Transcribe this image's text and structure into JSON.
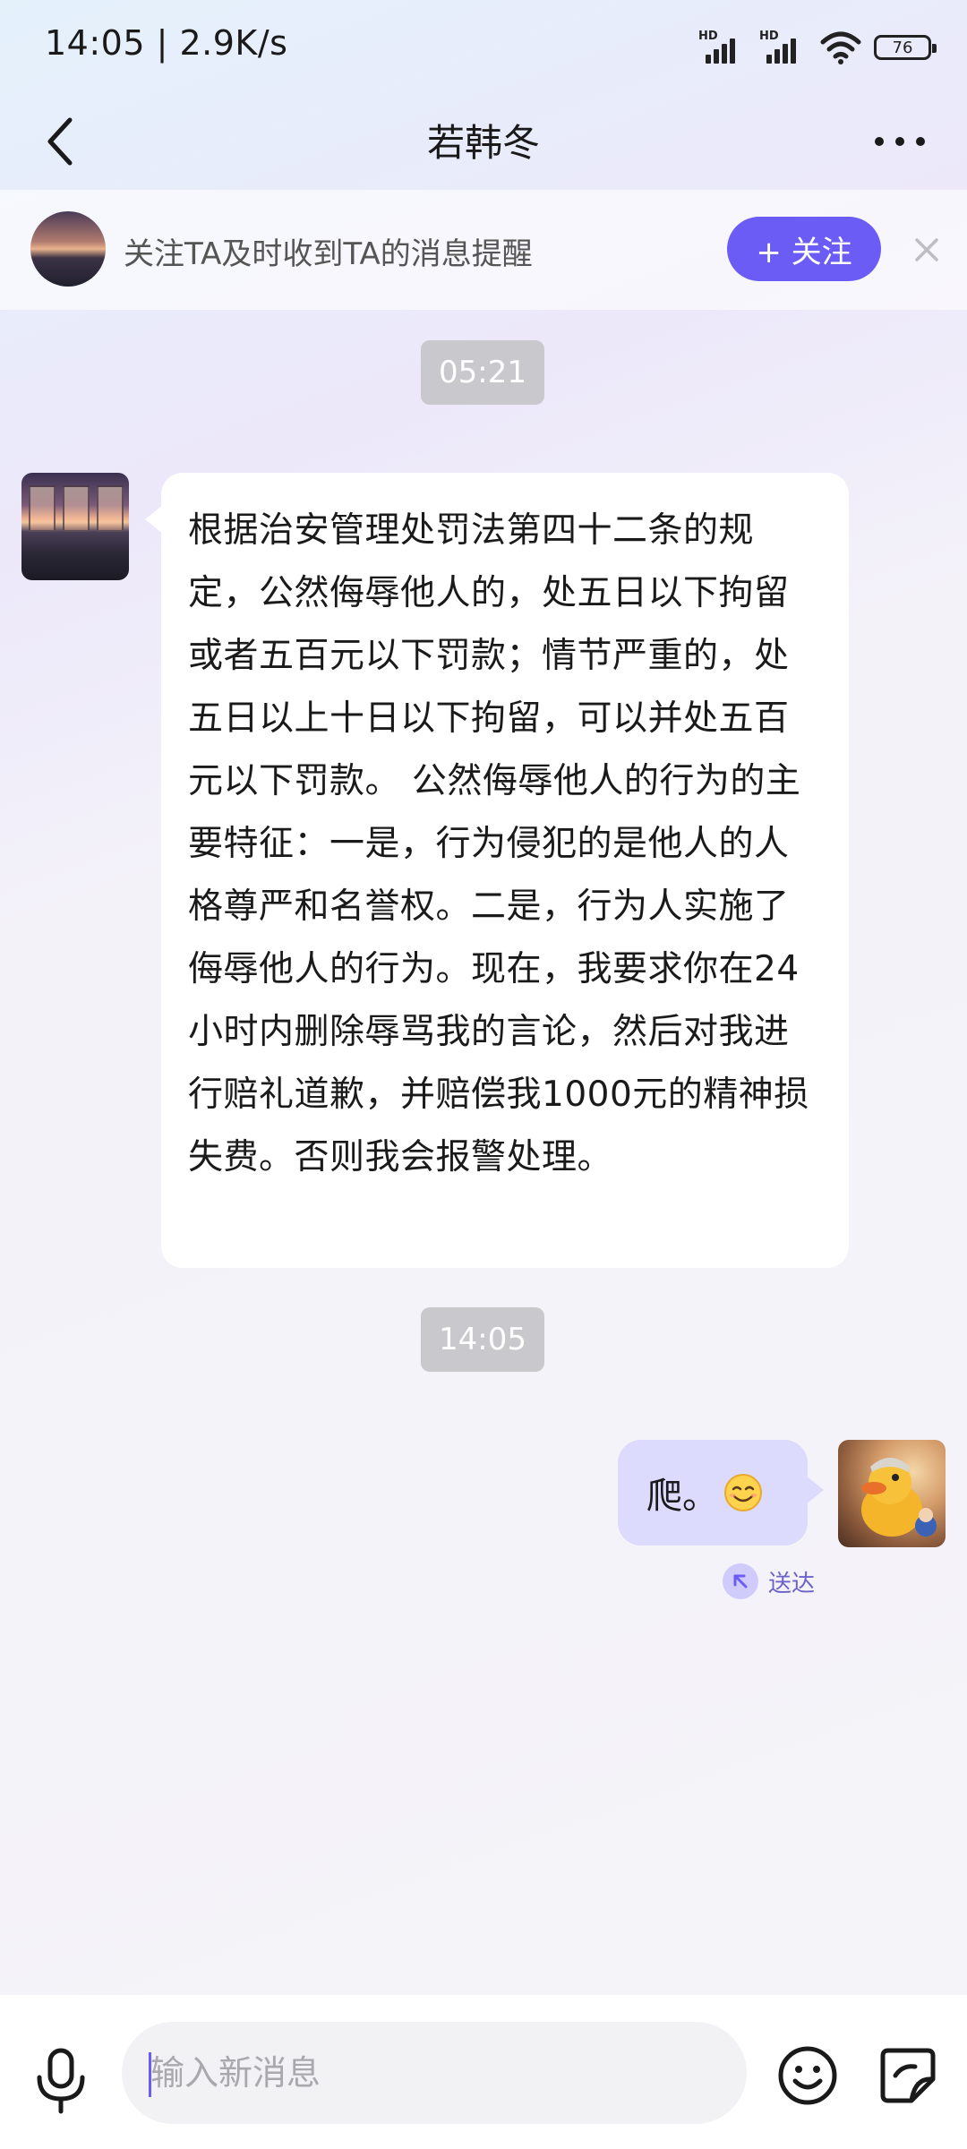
{
  "status_bar": {
    "time": "14:05 | 2.9K/s",
    "signal_1_label": "HD",
    "signal_2_label": "HD",
    "battery_level": "76"
  },
  "header": {
    "title": "若韩冬"
  },
  "follow_banner": {
    "text": "关注TA及时收到TA的消息提醒",
    "follow_label": "+ 关注"
  },
  "messages": {
    "timestamp_1": "05:21",
    "incoming_text": "根据治安管理处罚法第四十二条的规定，公然侮辱他人的，处五日以下拘留或者五百元以下罚款；情节严重的，处五日以上十日以下拘留，可以并处五百元以下罚款。 公然侮辱他人的行为的主要特征：一是，行为侵犯的是他人的人格尊严和名誉权。二是，行为人实施了侮辱他人的行为。现在，我要求你在24小时内删除辱骂我的言论，然后对我进行赔礼道歉，并赔偿我1000元的精神损失费。否则我会报警处理。",
    "timestamp_2": "14:05",
    "outgoing_text": "爬。",
    "outgoing_emoji": "smile-emoji",
    "delivered_label": "送达"
  },
  "input_bar": {
    "placeholder": "输入新消息"
  },
  "colors": {
    "accent": "#6b5cf6",
    "outgoing_bubble": "#dcdafd",
    "timestamp_bg": "#c9c9cd"
  }
}
